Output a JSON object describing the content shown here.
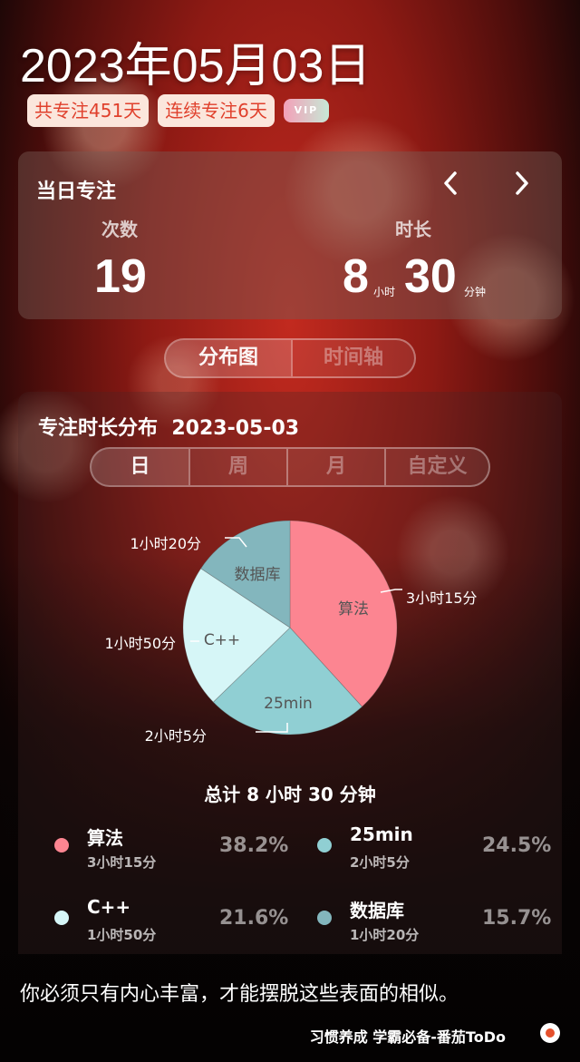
{
  "header": {
    "date": "2023年05月03日",
    "badge_total": "共专注451天",
    "badge_streak": "连续专注6天",
    "vip": "VIP"
  },
  "daily": {
    "title": "当日专注",
    "prev_icon": "chevron-left-icon",
    "next_icon": "chevron-right-icon",
    "count_label": "次数",
    "count_value": "19",
    "duration_label": "时长",
    "hours_value": "8",
    "hours_unit": "小时",
    "minutes_value": "30",
    "minutes_unit": "分钟"
  },
  "view_tabs": [
    {
      "label": "分布图",
      "active": true
    },
    {
      "label": "时间轴",
      "active": false
    }
  ],
  "distribution": {
    "title": "专注时长分布",
    "date": "2023-05-03",
    "period_tabs": [
      {
        "label": "日",
        "active": true
      },
      {
        "label": "周",
        "active": false
      },
      {
        "label": "月",
        "active": false
      },
      {
        "label": "自定义",
        "active": false
      }
    ],
    "total": "总计 8 小时 30 分钟"
  },
  "chart_data": {
    "type": "pie",
    "slices": [
      {
        "name": "算法",
        "minutes": 195,
        "time": "3小时15分",
        "percent": "38.2%",
        "color": "#fc8591"
      },
      {
        "name": "25min",
        "minutes": 125,
        "time": "2小时5分",
        "percent": "24.5%",
        "color": "#90cfd3"
      },
      {
        "name": "C++",
        "minutes": 110,
        "time": "1小时50分",
        "percent": "21.6%",
        "color": "#d6f6f7"
      },
      {
        "name": "数据库",
        "minutes": 80,
        "time": "1小时20分",
        "percent": "15.7%",
        "color": "#83b6bd"
      }
    ]
  },
  "quote": "你必须只有内心丰富，才能摆脱这些表面的相似。",
  "footer": "习惯养成 学霸必备-番茄ToDo"
}
